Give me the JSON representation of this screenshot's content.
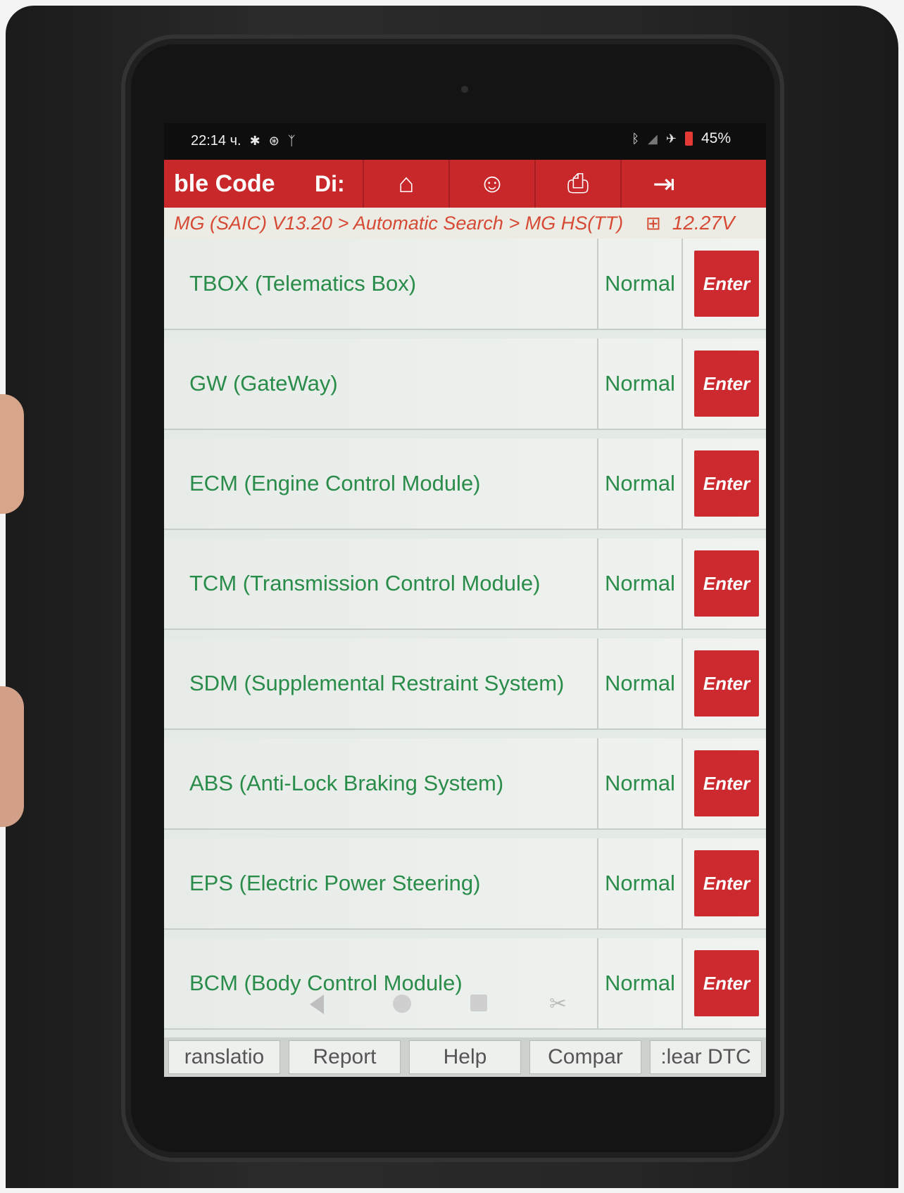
{
  "status_bar": {
    "time": "22:14 ч.",
    "left_icons": [
      "gear-icon",
      "bluetooth-circle-icon",
      "usb-diagnostic-icon"
    ],
    "right_icons": [
      "bluetooth-icon",
      "signal-icon",
      "airplane-icon",
      "battery-icon"
    ],
    "battery": "45%"
  },
  "toolbar": {
    "title": "ble Code",
    "tab_partial": "Di:",
    "buttons": [
      {
        "icon": "home-icon",
        "glyph": "⌂"
      },
      {
        "icon": "support-agent-icon",
        "glyph": "☺"
      },
      {
        "icon": "printer-icon",
        "glyph": "⎙"
      },
      {
        "icon": "exit-icon",
        "glyph": "⇥"
      }
    ]
  },
  "breadcrumb": {
    "path": "MG (SAIC) V13.20 > Automatic Search > MG HS(TT)",
    "battery_icon": "car-battery-icon",
    "voltage": "12.27V"
  },
  "systems": [
    {
      "name": "TBOX (Telematics Box)",
      "status": "Normal",
      "action": "Enter"
    },
    {
      "name": "GW (GateWay)",
      "status": "Normal",
      "action": "Enter"
    },
    {
      "name": "ECM (Engine Control Module)",
      "status": "Normal",
      "action": "Enter"
    },
    {
      "name": "TCM (Transmission Control Module)",
      "status": "Normal",
      "action": "Enter"
    },
    {
      "name": "SDM (Supplemental Restraint System)",
      "status": "Normal",
      "action": "Enter"
    },
    {
      "name": "ABS (Anti-Lock Braking System)",
      "status": "Normal",
      "action": "Enter"
    },
    {
      "name": "EPS (Electric Power Steering)",
      "status": "Normal",
      "action": "Enter"
    },
    {
      "name": "BCM (Body Control Module)",
      "status": "Normal",
      "action": "Enter"
    }
  ],
  "actions": [
    "ranslatio",
    "Report",
    "Help",
    "Compar",
    ":lear DTC"
  ],
  "colors": {
    "toolbar_red": "#c9282b",
    "enter_red": "#cc2a2e",
    "status_green": "#2a8c4a",
    "breadcrumb_text": "#d64a35"
  }
}
